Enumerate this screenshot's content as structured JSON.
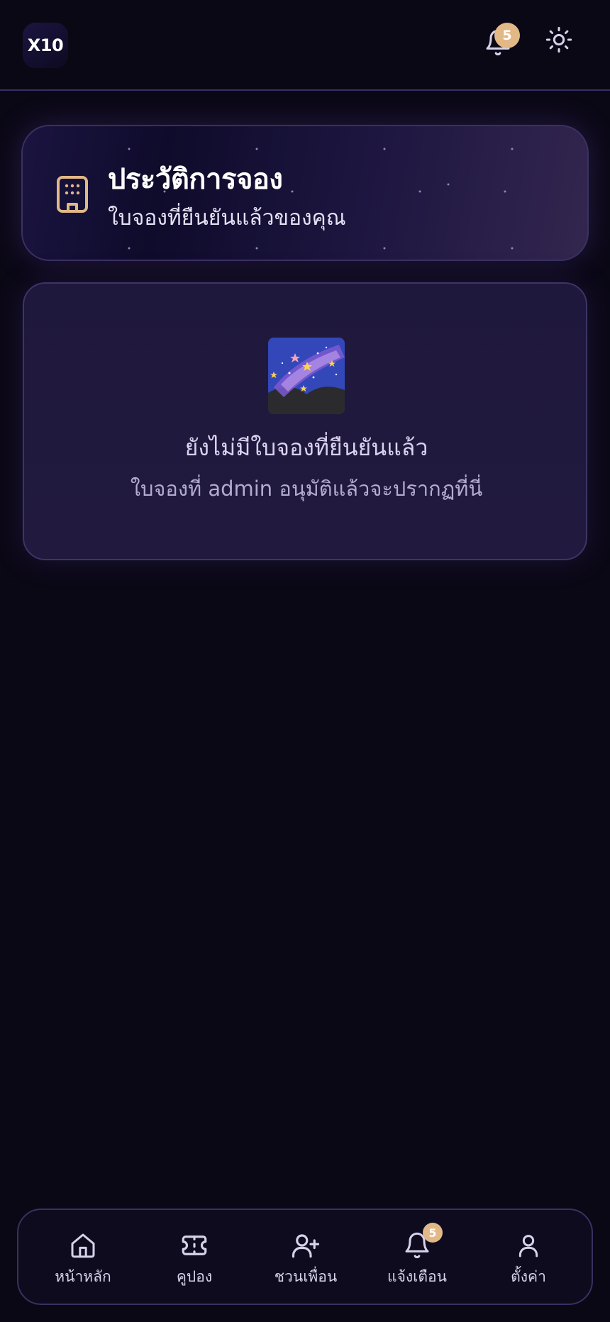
{
  "app": {
    "logo_text": "X10"
  },
  "header": {
    "notification_count": "5",
    "bell_icon": "bell-icon",
    "theme_icon": "sun-icon"
  },
  "history_card": {
    "title": "ประวัติการจอง",
    "subtitle": "ใบจองที่ยืนยันแล้วของคุณ",
    "icon": "building-icon",
    "accent_color": "#e2b887"
  },
  "empty_state": {
    "image": "milky-way-emoji",
    "title": "ยังไม่มีใบจองที่ยืนยันแล้ว",
    "description": "ใบจองที่ admin อนุมัติแล้วจะปรากฏที่นี่"
  },
  "bottom_nav": {
    "items": [
      {
        "label": "หน้าหลัก",
        "icon": "home-icon"
      },
      {
        "label": "คูปอง",
        "icon": "ticket-icon"
      },
      {
        "label": "ชวนเพื่อน",
        "icon": "user-plus-icon"
      },
      {
        "label": "แจ้งเตือน",
        "icon": "bell-icon",
        "badge": "5"
      },
      {
        "label": "ตั้งค่า",
        "icon": "user-icon"
      }
    ]
  },
  "colors": {
    "background": "#0b0816",
    "badge": "#e2b887",
    "card_border": "#3b3160"
  }
}
